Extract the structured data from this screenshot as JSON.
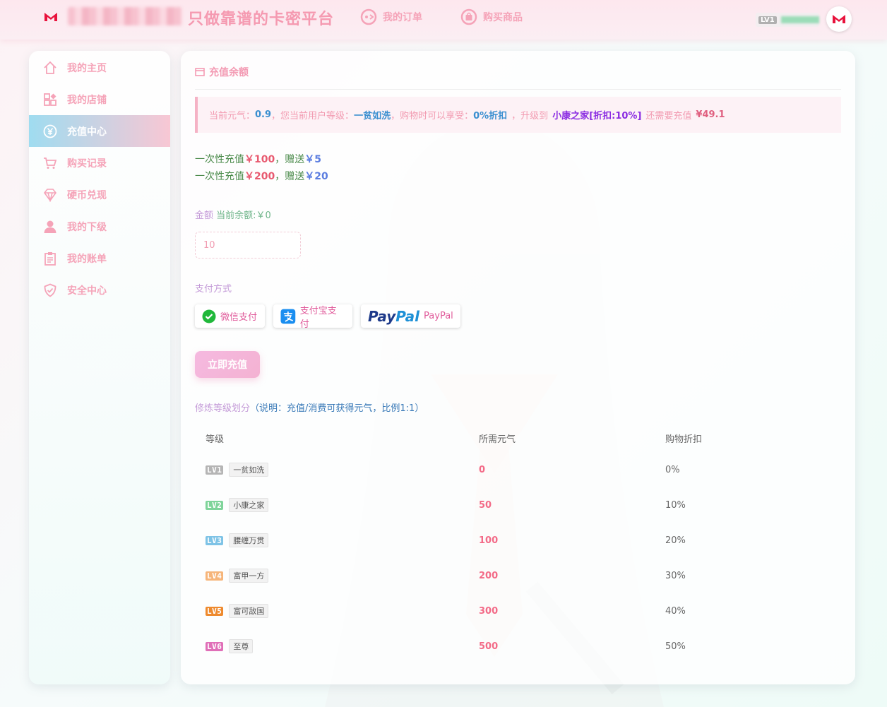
{
  "header": {
    "slogan": "只做靠谱的卡密平台",
    "nav": [
      {
        "label": "我的订单",
        "icon": "order-icon"
      },
      {
        "label": "购买商品",
        "icon": "shopping-bag-icon"
      }
    ],
    "user_level": "LV1"
  },
  "sidebar": {
    "items": [
      {
        "label": "我的主页",
        "icon": "home-icon",
        "active": false
      },
      {
        "label": "我的店铺",
        "icon": "shop-grid-icon",
        "active": false
      },
      {
        "label": "充值中心",
        "icon": "yen-icon",
        "active": true
      },
      {
        "label": "购买记录",
        "icon": "cart-icon",
        "active": false
      },
      {
        "label": "硬币兑现",
        "icon": "diamond-icon",
        "active": false
      },
      {
        "label": "我的下级",
        "icon": "user-icon",
        "active": false
      },
      {
        "label": "我的账单",
        "icon": "clipboard-icon",
        "active": false
      },
      {
        "label": "安全中心",
        "icon": "shield-icon",
        "active": false
      }
    ]
  },
  "main": {
    "title": "充值余额",
    "notice": {
      "p1": "当前元气：",
      "energy": "0.9",
      "p2": "，您当前用户等级：",
      "level": "一贫如洗",
      "p3": "，购物时可以享受：",
      "discount": "0%折扣",
      "p4": "，升级到",
      "next_level": "小康之家[折扣:10%]",
      "p5": "还需要充值",
      "need": "¥49.1"
    },
    "promos": [
      {
        "prefix": "一次性充值",
        "amount": "￥100",
        "mid": "，赠送",
        "gift": "￥5"
      },
      {
        "prefix": "一次性充值",
        "amount": "￥200",
        "mid": "，赠送",
        "gift": "￥20"
      }
    ],
    "amount_label": "金额",
    "balance_text": "当前余额:￥0",
    "amount_value": "10",
    "payment_label": "支付方式",
    "payments": [
      {
        "label": "微信支付",
        "icon": "wechat-pay-icon"
      },
      {
        "label": "支付宝支付",
        "icon": "alipay-icon"
      },
      {
        "label": "PayPal",
        "logo_a": "Pay",
        "logo_b": "Pal",
        "icon": "paypal-logo"
      }
    ],
    "submit_label": "立即充值",
    "level_title": "修炼等级划分",
    "level_note": "（说明：充值/消费可获得元气，比例1:1）",
    "table": {
      "headers": [
        "等级",
        "所需元气",
        "购物折扣"
      ],
      "rows": [
        {
          "lv": "LV1",
          "name": "一贫如洗",
          "energy": "0",
          "discount": "0%",
          "color": "#b5b5b5"
        },
        {
          "lv": "LV2",
          "name": "小康之家",
          "energy": "50",
          "discount": "10%",
          "color": "#7fd49a"
        },
        {
          "lv": "LV3",
          "name": "腰缠万贯",
          "energy": "100",
          "discount": "20%",
          "color": "#7ec3e6"
        },
        {
          "lv": "LV4",
          "name": "富甲一方",
          "energy": "200",
          "discount": "30%",
          "color": "#f6b57a"
        },
        {
          "lv": "LV5",
          "name": "富可敌国",
          "energy": "300",
          "discount": "40%",
          "color": "#ee8a2e"
        },
        {
          "lv": "LV6",
          "name": "至尊",
          "energy": "500",
          "discount": "50%",
          "color": "#e06fb8"
        }
      ]
    }
  },
  "colors": {
    "accent_pink": "#f5a3b8",
    "active_gradient_start": "#9fdcf0",
    "active_gradient_end": "#f8c7d4",
    "energy_red": "#f36a87"
  }
}
